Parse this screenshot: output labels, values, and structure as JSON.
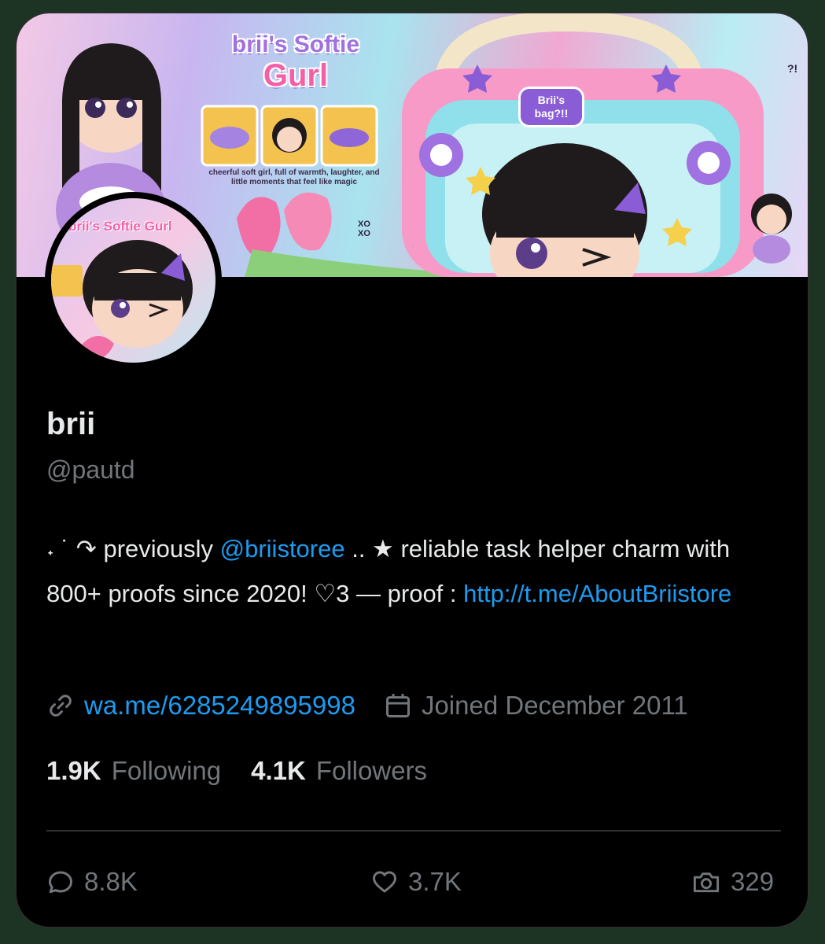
{
  "banner": {
    "title_line1": "brii's Softie",
    "title_line2": "Gurl",
    "caption": "cheerful soft girl, full of warmth, laughter, and little moments that feel like magic",
    "bag_tag": "Brii's bag?!!",
    "mark_top_right": "?!",
    "mark_xo": "XO XO"
  },
  "avatar": {
    "title": "brii's Softie Gurl"
  },
  "profile": {
    "display_name": "brii",
    "handle": "@pautd"
  },
  "bio": {
    "prefix": "˖ ˙ ↷ previously ",
    "mention": "@briistoree",
    "middle": " ..  ★ reliable task helper charm with 800+ proofs since 2020! ♡3 — proof : ",
    "url": "http://t.me/AboutBriistore"
  },
  "meta": {
    "link_icon": "link-icon",
    "website": "wa.me/6285249895998",
    "calendar_icon": "calendar-icon",
    "joined": "Joined December 2011"
  },
  "stats": {
    "following_count": "1.9K",
    "following_label": "Following",
    "followers_count": "4.1K",
    "followers_label": "Followers"
  },
  "actions": {
    "replies": "8.8K",
    "likes": "3.7K",
    "media": "329"
  },
  "colors": {
    "background": "#000000",
    "page": "#1d3324",
    "text": "#e7e9ea",
    "muted": "#71767b",
    "link": "#1d9bf0"
  }
}
